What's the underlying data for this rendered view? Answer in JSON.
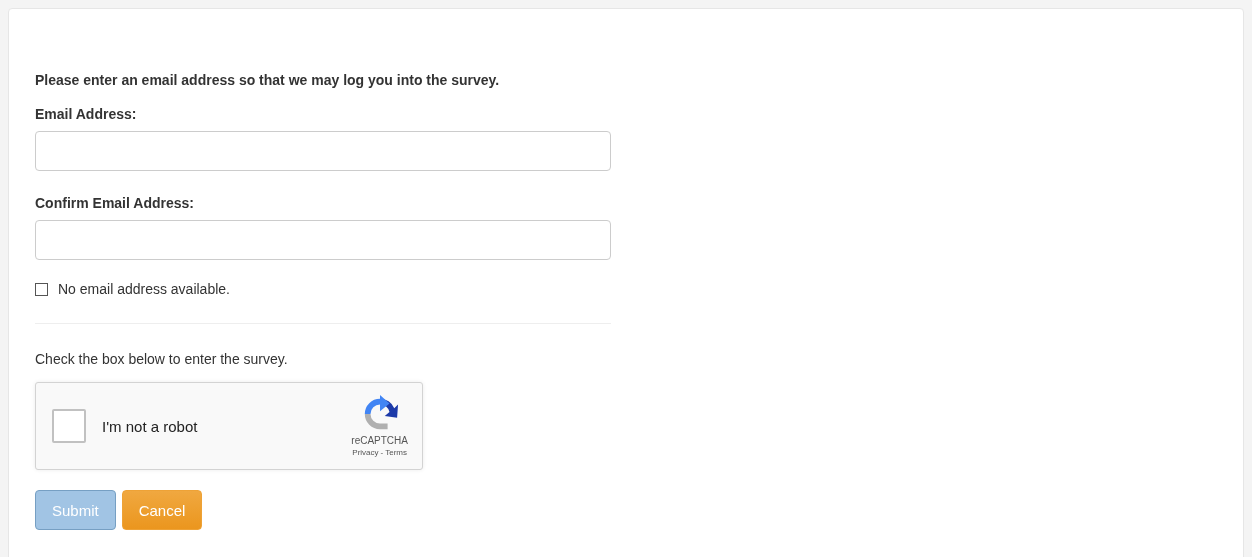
{
  "intro": "Please enter an email address so that we may log you into the survey.",
  "fields": [
    {
      "label": "Email Address:"
    },
    {
      "label": "Confirm Email Address:"
    }
  ],
  "no_email": {
    "label": "No email address available.",
    "checked": false
  },
  "captcha_prompt": "Check the box below to enter the survey.",
  "captcha": {
    "label": "I'm not a robot",
    "checked": false,
    "brand": "reCAPTCHA",
    "privacy": "Privacy",
    "separator": "-",
    "terms": "Terms"
  },
  "buttons": [
    {
      "label": "Submit",
      "kind": "primary",
      "disabled": true
    },
    {
      "label": "Cancel",
      "kind": "warning",
      "disabled": false
    }
  ]
}
